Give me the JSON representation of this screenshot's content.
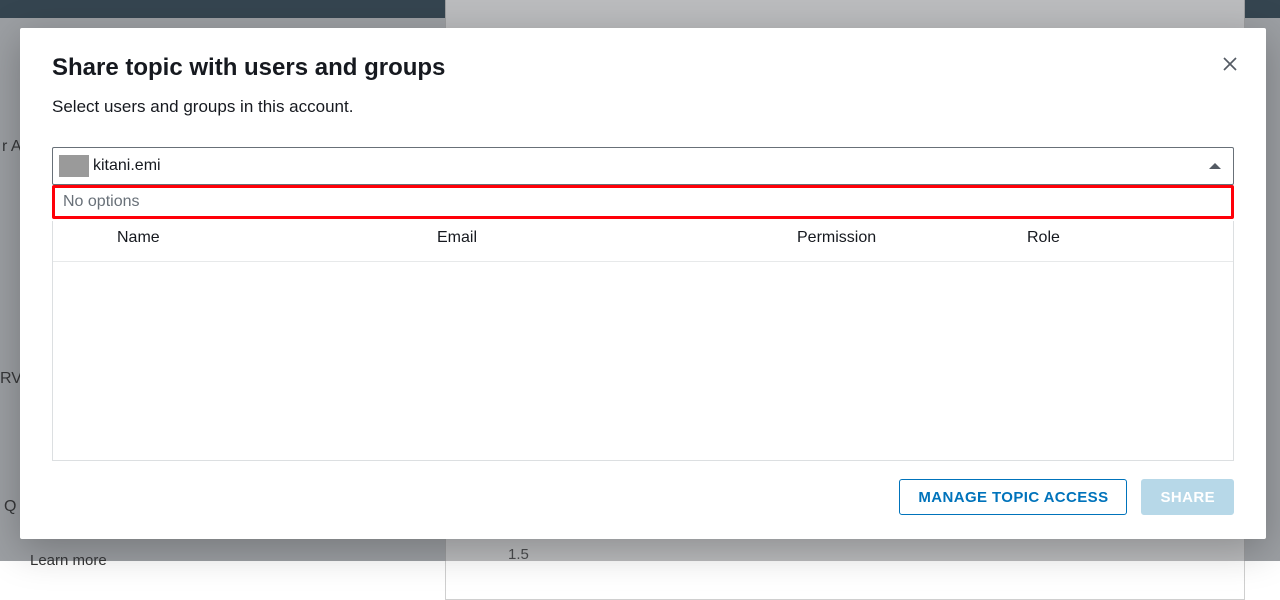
{
  "background": {
    "left_fragment_1": "r A",
    "left_fragment_2": "RV",
    "left_fragment_3": "Q",
    "bottom_fragment": "Learn more",
    "axis_value": "1.5"
  },
  "modal": {
    "title": "Share topic with users and groups",
    "subtitle": "Select users and groups in this account.",
    "close_label": "Close"
  },
  "search": {
    "value": "kitani.emi",
    "dropdown_message": "No options"
  },
  "table": {
    "columns": {
      "name": "Name",
      "email": "Email",
      "permission": "Permission",
      "role": "Role"
    },
    "rows": []
  },
  "footer": {
    "manage_label": "MANAGE TOPIC ACCESS",
    "share_label": "SHARE"
  }
}
